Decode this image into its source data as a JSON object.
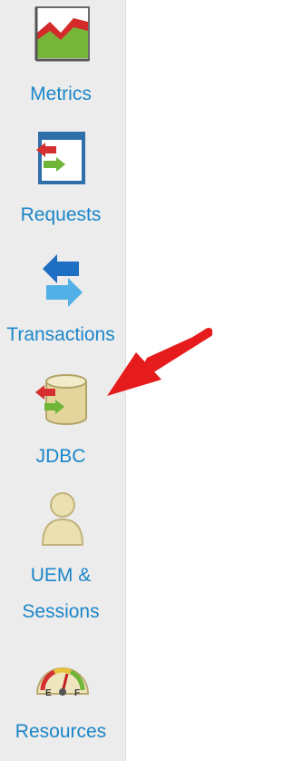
{
  "sidebar": {
    "items": [
      {
        "label": "Metrics",
        "icon": "metrics-chart-icon"
      },
      {
        "label": "Requests",
        "icon": "requests-document-icon"
      },
      {
        "label": "Transactions",
        "icon": "transactions-arrows-icon"
      },
      {
        "label": "JDBC",
        "icon": "jdbc-database-icon"
      },
      {
        "label_line1": "UEM &",
        "label_line2": "Sessions",
        "icon": "user-sessions-icon"
      },
      {
        "label": "Resources",
        "icon": "resources-gauge-icon"
      }
    ]
  },
  "annotation": {
    "pointer_color": "#e61b1b",
    "pointer_icon": "red-pointer-arrow"
  },
  "colors": {
    "sidebar_bg": "#ececec",
    "link_blue": "#1b86c9"
  }
}
